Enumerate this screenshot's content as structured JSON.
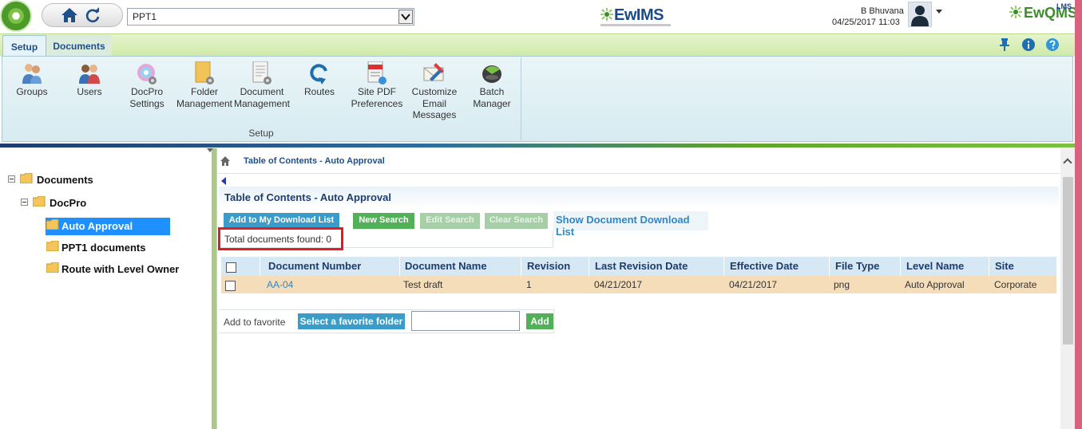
{
  "header": {
    "project_value": "PPT1",
    "brand_center": "EwIMS",
    "brand_right": "EwQMS",
    "brand_right_sup": "LMS",
    "user_name": "B Bhuvana",
    "datetime": "04/25/2017 11:03"
  },
  "tabs": [
    {
      "label": "Setup",
      "active": true
    },
    {
      "label": "Documents",
      "active": false
    }
  ],
  "ribbon": {
    "group_label": "Setup",
    "buttons": [
      {
        "label": "Groups",
        "icon": "groups-icon"
      },
      {
        "label": "Users",
        "icon": "users-icon"
      },
      {
        "label": "DocPro Settings",
        "icon": "docpro-settings-icon"
      },
      {
        "label": "Folder Management",
        "icon": "folder-management-icon"
      },
      {
        "label": "Document Management",
        "icon": "document-management-icon"
      },
      {
        "label": "Routes",
        "icon": "routes-icon"
      },
      {
        "label": "Site PDF Preferences",
        "icon": "pdf-preferences-icon"
      },
      {
        "label": "Customize Email Messages",
        "icon": "email-icon"
      },
      {
        "label": "Batch Manager",
        "icon": "batch-manager-icon"
      }
    ]
  },
  "tree": {
    "root": "Documents",
    "child": "DocPro",
    "items": [
      {
        "label": "Auto Approval",
        "selected": true
      },
      {
        "label": "PPT1 documents",
        "selected": false
      },
      {
        "label": "Route with Level Owner",
        "selected": false
      }
    ]
  },
  "content": {
    "breadcrumb": "Table of Contents - Auto Approval",
    "title": "Table of Contents - Auto Approval",
    "buttons": {
      "add_download": "Add to My Download List",
      "new_search": "New Search",
      "edit_search": "Edit Search",
      "clear_search": "Clear Search",
      "show_download": "Show Document Download List"
    },
    "total_found": "Total documents found: 0",
    "columns": [
      "Document Number",
      "Document Name",
      "Revision",
      "Last Revision Date",
      "Effective Date",
      "File Type",
      "Level Name",
      "Site"
    ],
    "rows": [
      [
        "AA-04",
        "Test draft",
        "1",
        "04/21/2017",
        "04/21/2017",
        "png",
        "Auto Approval",
        "Corporate"
      ]
    ],
    "favorite": {
      "label": "Add to favorite",
      "select_folder": "Select a favorite folder",
      "input_value": "",
      "add": "Add"
    }
  },
  "colors": {
    "accent_blue": "#3a9cc8",
    "accent_green": "#52b058",
    "selected_row": "#f6ddb9",
    "tree_selection": "#1e90ff",
    "highlight_box": "#e01c24"
  }
}
